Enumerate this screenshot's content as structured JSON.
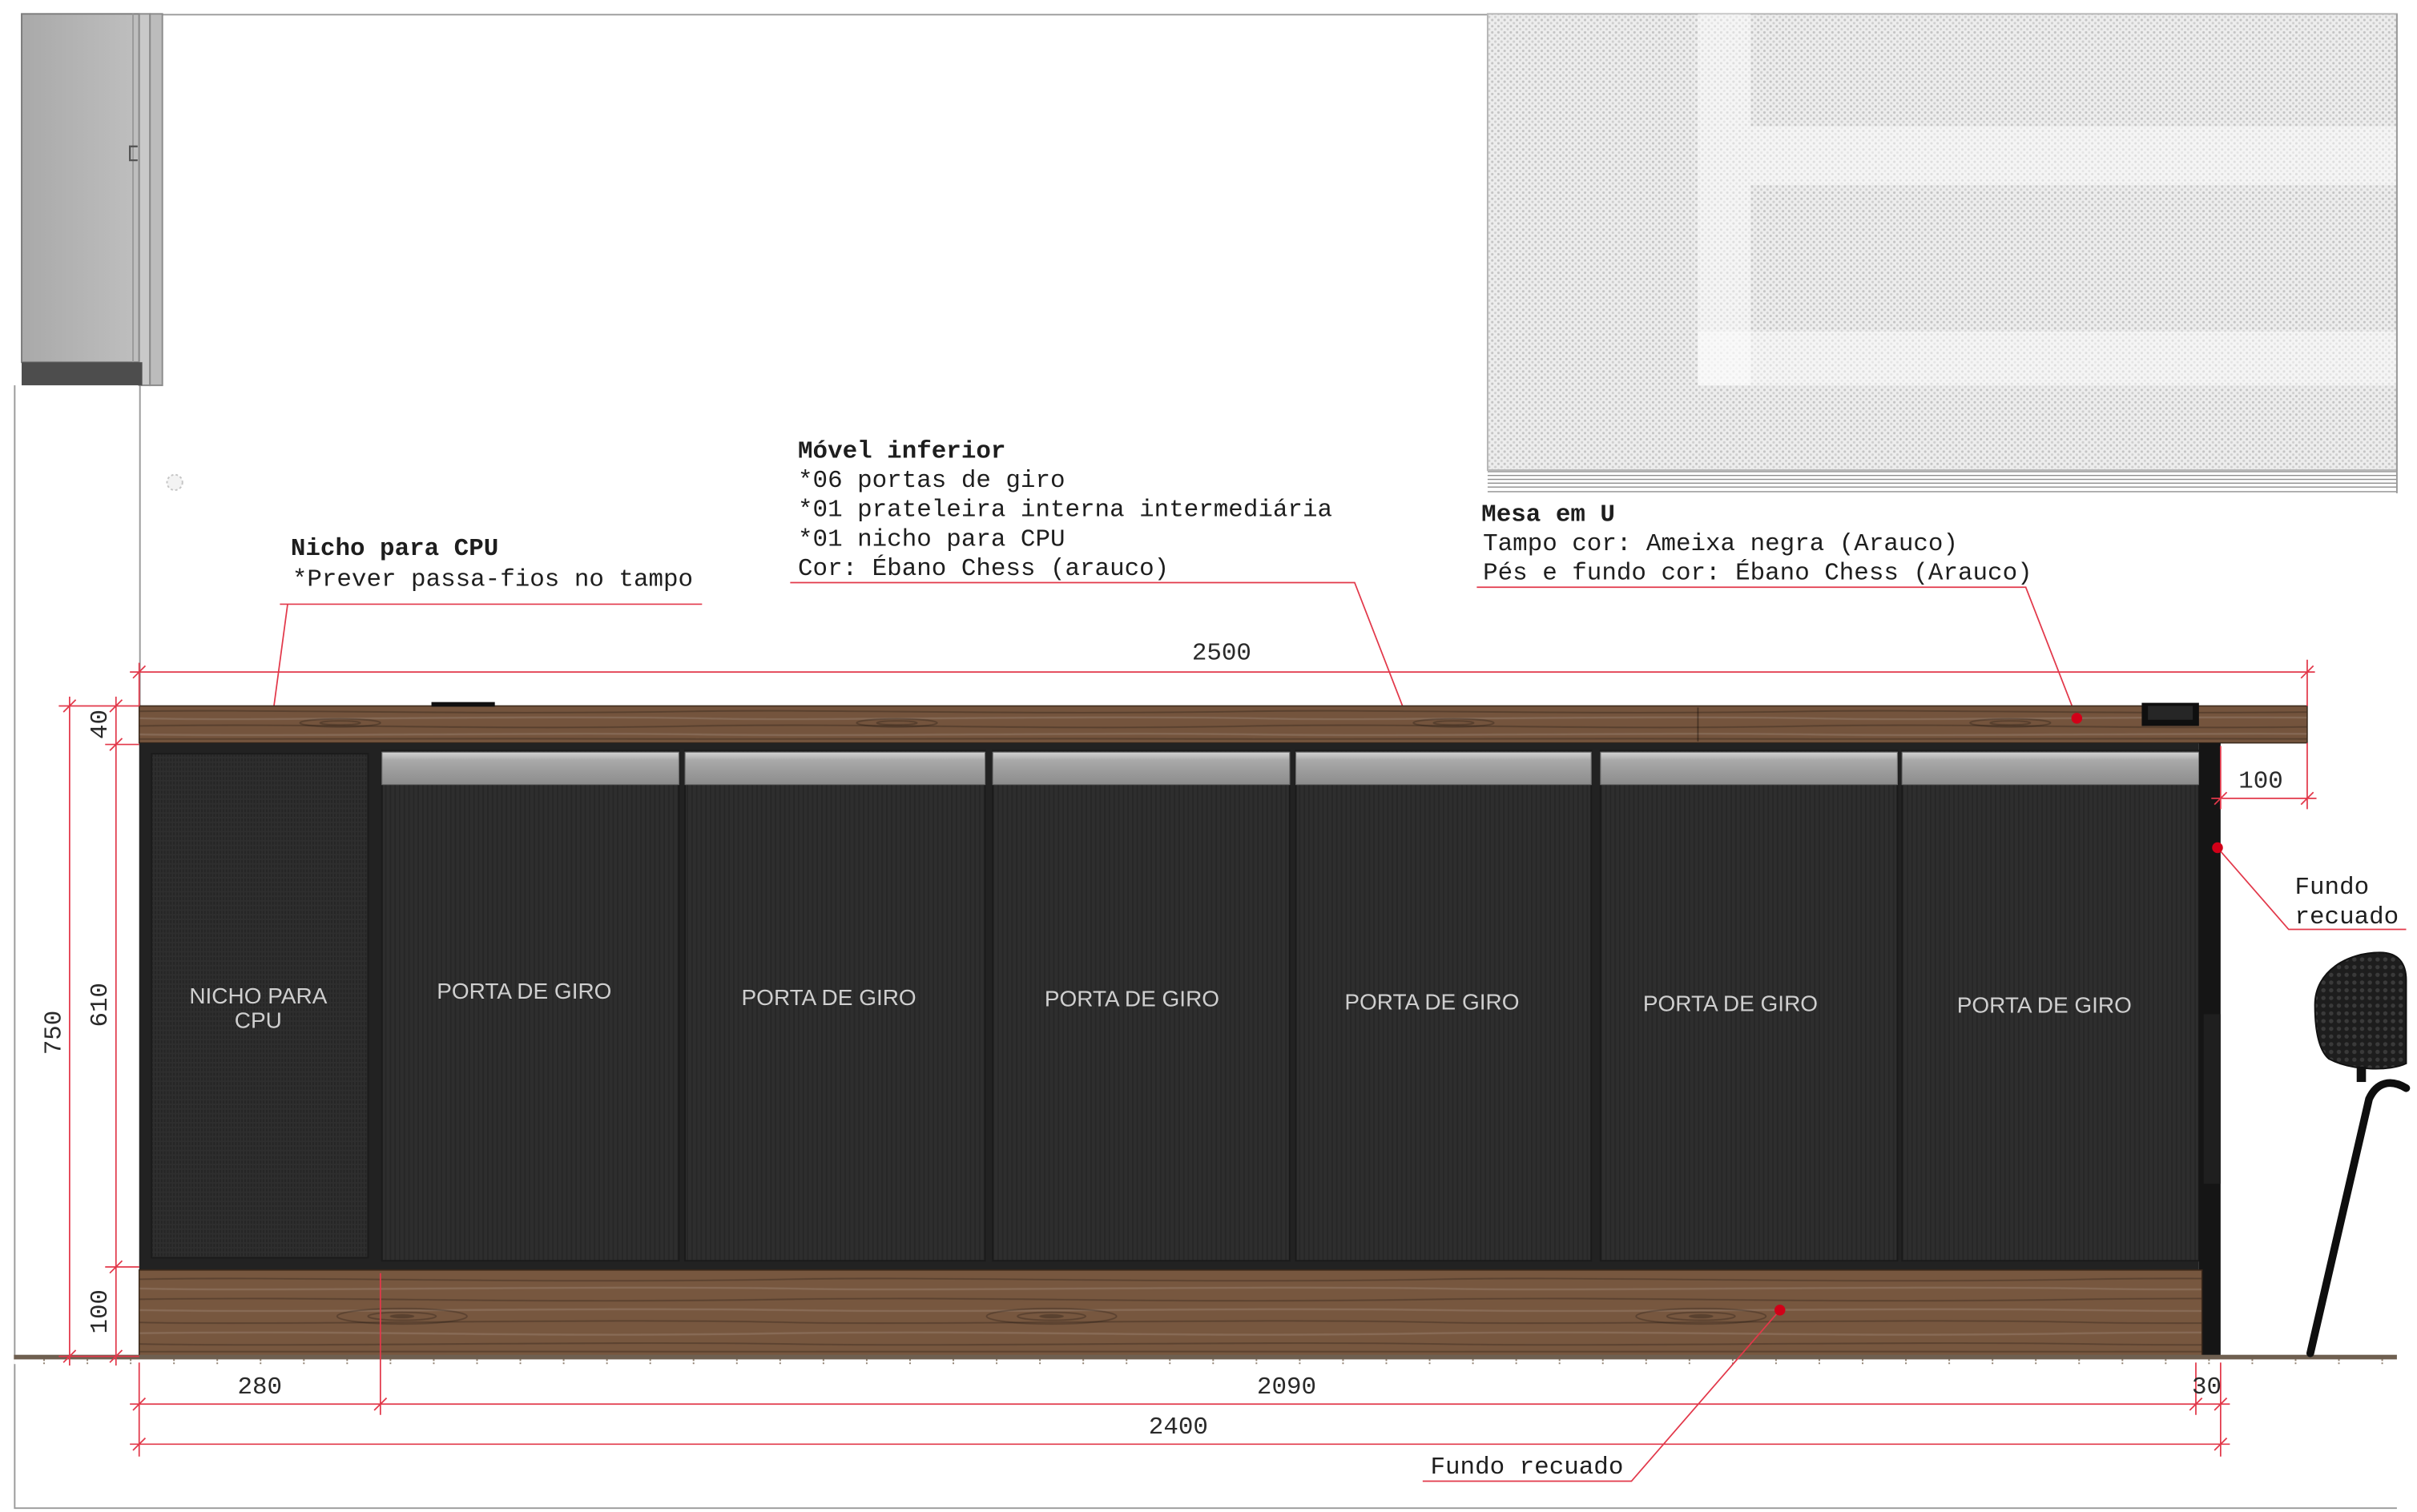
{
  "notes": {
    "niche": {
      "title": "Nicho para CPU",
      "detail": "*Prever passa-fios no tampo"
    },
    "lower_cabinet": {
      "title": "Móvel inferior",
      "details": [
        "*06 portas de giro",
        "*01 prateleira interna intermediária",
        "*01 nicho para CPU",
        "Cor: Ébano Chess (arauco)"
      ]
    },
    "u_desk": {
      "title": "Mesa em U",
      "details": [
        "Tampo cor: Ameixa negra (Arauco)",
        "Pés e fundo cor: Ébano Chess (Arauco)"
      ]
    },
    "recessed_back_side": [
      "Fundo",
      "recuado"
    ],
    "recessed_back_front": "Fundo recuado"
  },
  "dimensions": {
    "desk_width": "2500",
    "total_height": "750",
    "top_thickness": "40",
    "cabinet_height": "610",
    "back_panel_height": "100",
    "leg_offset": "100",
    "niche_width": "280",
    "doors_width": "2090",
    "side_gap": "30",
    "cabinet_width": "2400"
  },
  "cabinet": {
    "niche_label": [
      "NICHO PARA",
      "CPU"
    ],
    "door_labels": [
      "PORTA DE GIRO",
      "PORTA DE GIRO",
      "PORTA DE GIRO",
      "PORTA DE GIRO",
      "PORTA DE GIRO",
      "PORTA DE GIRO"
    ]
  },
  "colors": {
    "dimension_line": "#e2384a",
    "marker_dot": "#d10018",
    "countertop_wood": "#74543d",
    "back_panel_wood": "#77573f",
    "cabinet_body": "#2e2e2e",
    "door_handle": "#a9a9a9"
  }
}
